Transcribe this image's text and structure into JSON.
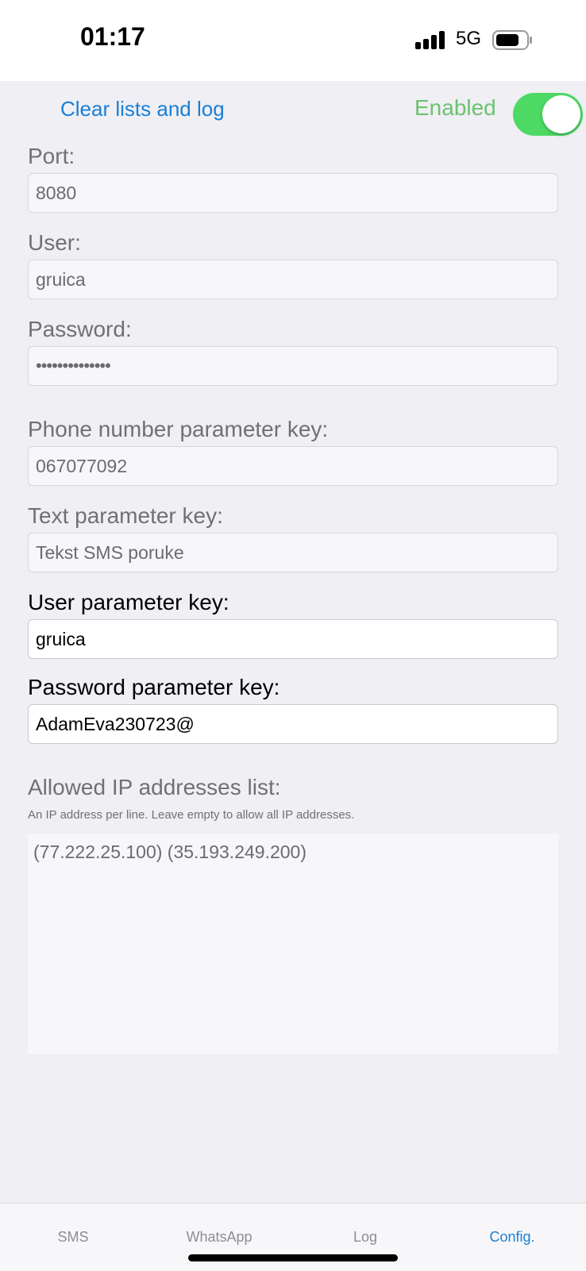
{
  "status_bar": {
    "time": "01:17",
    "network": "5G"
  },
  "header": {
    "clear_label": "Clear lists and log",
    "enabled_label": "Enabled",
    "enabled": true
  },
  "fields": {
    "port": {
      "label": "Port:",
      "value": "8080"
    },
    "user": {
      "label": "User:",
      "value": "gruica"
    },
    "password": {
      "label": "Password:",
      "value": "••••••••••••••"
    },
    "phone_key": {
      "label": "Phone number parameter key:",
      "value": "067077092"
    },
    "text_key": {
      "label": "Text parameter key:",
      "value": "Tekst SMS poruke"
    },
    "user_key": {
      "label": "User parameter key:",
      "value": "gruica"
    },
    "password_key": {
      "label": "Password parameter key:",
      "value": "AdamEva230723@"
    }
  },
  "ip_list": {
    "label": "Allowed IP addresses list:",
    "hint": "An IP address per line. Leave empty to allow all IP addresses.",
    "value": "(77.222.25.100)  (35.193.249.200)"
  },
  "tabs": [
    {
      "label": "SMS"
    },
    {
      "label": "WhatsApp"
    },
    {
      "label": "Log"
    },
    {
      "label": "Config."
    }
  ],
  "active_tab": "Config.",
  "colors": {
    "accent": "#1a7fd6",
    "toggle_on": "#4cd964",
    "enabled_text": "#6cc26e"
  }
}
